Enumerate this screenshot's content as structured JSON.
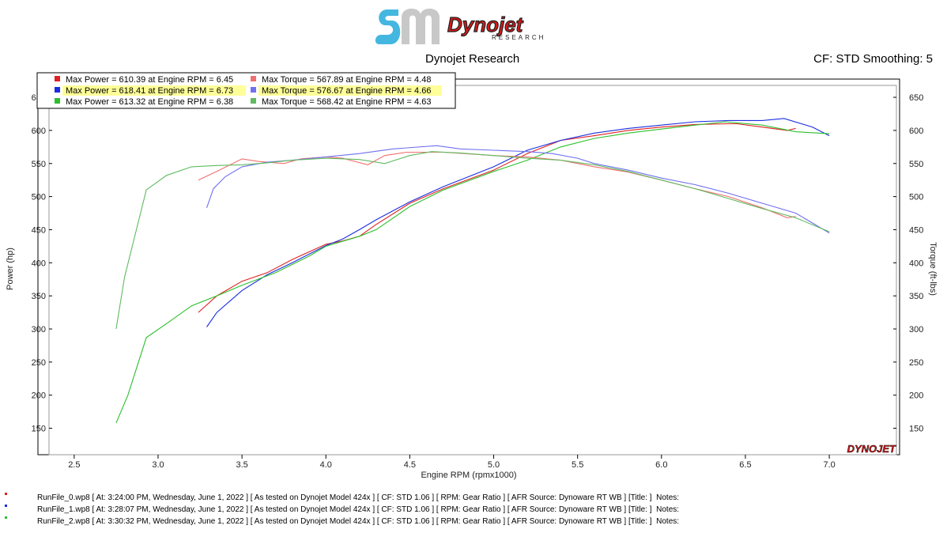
{
  "header": {
    "logo_text": "Dynojet",
    "logo_subtext": "RESEARCH",
    "title": "Dynojet Research",
    "cf_text": "CF: STD Smoothing: 5"
  },
  "colors": {
    "run0": "#e02020",
    "run1": "#1a2ee0",
    "run2": "#2cc02c",
    "run0_torque": "#f07070",
    "run1_torque": "#7070f0",
    "run2_torque": "#60bb60",
    "legend_highlight": "#ffff99"
  },
  "chart_data": {
    "type": "line",
    "xlabel": "Engine RPM (rpmx1000)",
    "ylabel_left": "Power (hp)",
    "ylabel_right": "Torque (ft-lbs)",
    "xlim": [
      2.35,
      7.4
    ],
    "ylim": [
      110,
      668
    ],
    "x_ticks": [
      "2.5",
      "3.0",
      "3.5",
      "4.0",
      "4.5",
      "5.0",
      "5.5",
      "6.0",
      "6.5",
      "7.0"
    ],
    "y_ticks": [
      "150",
      "200",
      "250",
      "300",
      "350",
      "400",
      "450",
      "500",
      "550",
      "600",
      "650"
    ],
    "watermark": "DYNOJET",
    "legend": [
      {
        "label": "Max Power = 610.39 at Engine RPM = 6.45",
        "color_key": "run0",
        "highlight": false
      },
      {
        "label": "Max Power = 618.41 at Engine RPM = 6.73",
        "color_key": "run1",
        "highlight": true
      },
      {
        "label": "Max Power = 613.32 at Engine RPM = 6.38",
        "color_key": "run2",
        "highlight": false
      },
      {
        "label": "Max Torque = 567.89 at Engine RPM = 4.48",
        "color_key": "run0_torque",
        "highlight": false
      },
      {
        "label": "Max Torque = 576.67 at Engine RPM = 4.66",
        "color_key": "run1_torque",
        "highlight": true
      },
      {
        "label": "Max Torque = 568.42 at Engine RPM = 4.63",
        "color_key": "run2_torque",
        "highlight": false
      }
    ],
    "series": [
      {
        "key": "power0",
        "color_key": "run0",
        "x": [
          3.24,
          3.35,
          3.5,
          3.65,
          3.8,
          4.0,
          4.1,
          4.2,
          4.3,
          4.5,
          4.7,
          5.0,
          5.2,
          5.4,
          5.6,
          5.8,
          6.0,
          6.2,
          6.4,
          6.45,
          6.6,
          6.75,
          6.8
        ],
        "y": [
          325,
          350,
          372,
          385,
          405,
          428,
          433,
          440,
          458,
          490,
          512,
          540,
          565,
          585,
          592,
          600,
          605,
          609,
          610,
          610,
          605,
          600,
          603
        ]
      },
      {
        "key": "power1",
        "color_key": "run1",
        "x": [
          3.29,
          3.35,
          3.5,
          3.65,
          3.8,
          4.0,
          4.1,
          4.2,
          4.3,
          4.5,
          4.7,
          5.0,
          5.2,
          5.4,
          5.6,
          5.8,
          6.0,
          6.2,
          6.4,
          6.6,
          6.73,
          6.9,
          7.0
        ],
        "y": [
          303,
          325,
          358,
          382,
          400,
          426,
          436,
          450,
          465,
          492,
          515,
          545,
          570,
          585,
          596,
          603,
          608,
          613,
          615,
          615,
          618,
          605,
          592
        ]
      },
      {
        "key": "power2",
        "color_key": "run2",
        "x": [
          2.75,
          2.82,
          2.93,
          3.05,
          3.2,
          3.35,
          3.5,
          3.7,
          3.9,
          4.0,
          4.2,
          4.3,
          4.5,
          4.7,
          5.0,
          5.2,
          5.4,
          5.6,
          5.8,
          6.0,
          6.2,
          6.38,
          6.6,
          6.8,
          7.0
        ],
        "y": [
          158,
          200,
          287,
          308,
          335,
          350,
          366,
          385,
          410,
          425,
          440,
          450,
          485,
          510,
          538,
          555,
          575,
          588,
          596,
          602,
          608,
          613,
          608,
          598,
          595
        ]
      },
      {
        "key": "torque0",
        "color_key": "run0_torque",
        "x": [
          3.24,
          3.35,
          3.5,
          3.6,
          3.75,
          3.85,
          4.0,
          4.1,
          4.25,
          4.35,
          4.48,
          4.7,
          5.0,
          5.2,
          5.4,
          5.6,
          5.8,
          6.0,
          6.2,
          6.4,
          6.6,
          6.75,
          6.8
        ],
        "y": [
          525,
          538,
          557,
          553,
          550,
          557,
          560,
          558,
          548,
          562,
          567,
          567,
          562,
          560,
          555,
          545,
          537,
          525,
          512,
          500,
          483,
          468,
          470
        ]
      },
      {
        "key": "torque1",
        "color_key": "run1_torque",
        "x": [
          3.29,
          3.33,
          3.4,
          3.5,
          3.65,
          3.8,
          4.0,
          4.2,
          4.4,
          4.66,
          4.8,
          5.0,
          5.2,
          5.35,
          5.5,
          5.6,
          5.8,
          6.0,
          6.2,
          6.4,
          6.6,
          6.8,
          7.0
        ],
        "y": [
          483,
          512,
          530,
          545,
          552,
          555,
          560,
          565,
          572,
          577,
          572,
          570,
          568,
          565,
          558,
          550,
          540,
          528,
          518,
          505,
          490,
          475,
          445
        ]
      },
      {
        "key": "torque2",
        "color_key": "run2_torque",
        "x": [
          2.75,
          2.8,
          2.93,
          3.05,
          3.2,
          3.35,
          3.5,
          3.65,
          3.8,
          4.0,
          4.2,
          4.35,
          4.5,
          4.63,
          4.8,
          5.0,
          5.2,
          5.4,
          5.6,
          5.8,
          6.0,
          6.2,
          6.4,
          6.6,
          6.8,
          7.0
        ],
        "y": [
          300,
          378,
          510,
          532,
          545,
          547,
          548,
          551,
          555,
          558,
          556,
          550,
          562,
          568,
          566,
          562,
          558,
          555,
          548,
          538,
          525,
          512,
          497,
          482,
          468,
          447
        ]
      }
    ]
  },
  "run_files": [
    {
      "text": "RunFile_0.wp8 [ At: 3:24:00 PM, Wednesday, June 1, 2022 ] [ As tested on Dynojet Model 424x ] [ CF: STD 1.06 ] [ RPM: Gear Ratio ] [ AFR Source: Dynoware RT WB ] [Title: ]  Notes:",
      "color_key": "run0"
    },
    {
      "text": "RunFile_1.wp8 [ At: 3:28:07 PM, Wednesday, June 1, 2022 ] [ As tested on Dynojet Model 424x ] [ CF: STD 1.06 ] [ RPM: Gear Ratio ] [ AFR Source: Dynoware RT WB ] [Title: ]  Notes:",
      "color_key": "run1"
    },
    {
      "text": "RunFile_2.wp8 [ At: 3:30:32 PM, Wednesday, June 1, 2022 ] [ As tested on Dynojet Model 424x ] [ CF: STD 1.06 ] [ RPM: Gear Ratio ] [ AFR Source: Dynoware RT WB ] [Title: ]  Notes:",
      "color_key": "run2"
    }
  ]
}
